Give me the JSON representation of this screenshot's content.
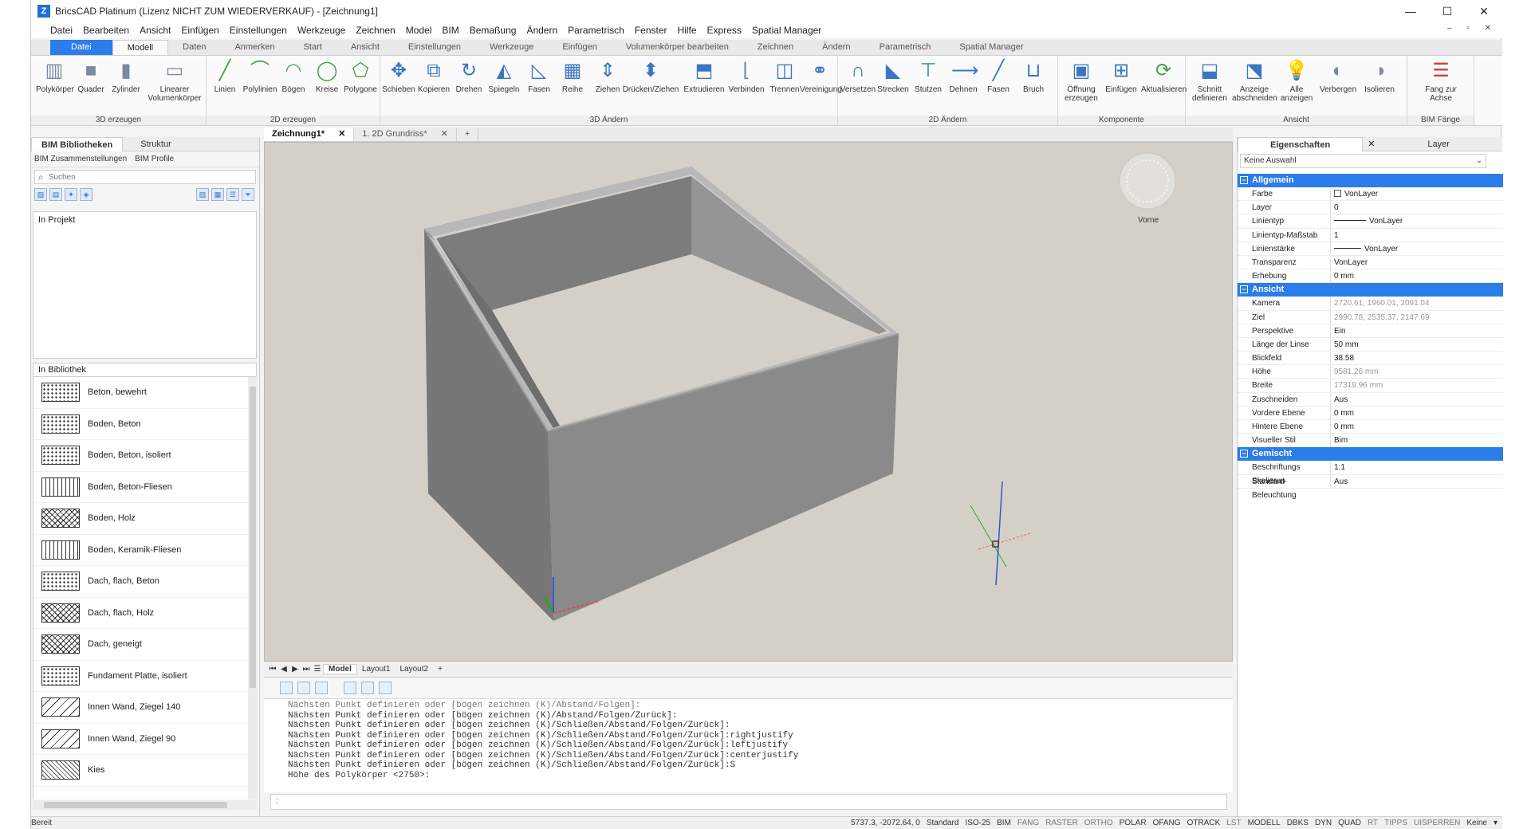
{
  "window": {
    "title": "BricsCAD Platinum (Lizenz NICHT ZUM WIEDERVERKAUF) - [Zeichnung1]",
    "min": "—",
    "max": "☐",
    "close": "✕"
  },
  "menu": [
    "Datei",
    "Bearbeiten",
    "Ansicht",
    "Einfügen",
    "Einstellungen",
    "Werkzeuge",
    "Zeichnen",
    "Model",
    "BIM",
    "Bemaßung",
    "Ändern",
    "Parametrisch",
    "Fenster",
    "Hilfe",
    "Express",
    "Spatial Manager"
  ],
  "ribbon_tabs": [
    "Datei",
    "Modell",
    "Daten",
    "Anmerken",
    "Start",
    "Ansicht",
    "Einstellungen",
    "Werkzeuge",
    "Einfügen",
    "Volumenkörper bearbeiten",
    "Zeichnen",
    "Ändern",
    "Parametrisch",
    "Spatial Manager"
  ],
  "ribbon": {
    "groups": [
      {
        "label": "3D erzeugen",
        "buttons": [
          "Polykörper",
          "Quader",
          "Zylinder",
          "Linearer Volumenkörper"
        ]
      },
      {
        "label": "2D erzeugen",
        "buttons": [
          "Linien",
          "Polylinien",
          "Bögen",
          "Kreise",
          "Polygone"
        ]
      },
      {
        "label": "3D Ändern",
        "buttons": [
          "Schieben",
          "Kopieren",
          "Drehen",
          "Spiegeln",
          "Fasen",
          "Reihe",
          "Ziehen",
          "Drücken/Ziehen",
          "Extrudieren",
          "Verbinden",
          "Trennen",
          "Vereinigung"
        ]
      },
      {
        "label": "2D Ändern",
        "buttons": [
          "Versetzen",
          "Strecken",
          "Stutzen",
          "Dehnen",
          "Fasen",
          "Bruch"
        ]
      },
      {
        "label": "Komponente",
        "buttons": [
          "Öffnung erzeugen",
          "Einfügen",
          "Aktualisieren"
        ]
      },
      {
        "label": "Ansicht",
        "buttons": [
          "Schnitt definieren",
          "Anzeige abschneiden",
          "Alle anzeigen",
          "Verbergen",
          "Isolieren"
        ]
      },
      {
        "label": "BIM Fänge",
        "buttons": [
          "Fang zur Achse"
        ]
      }
    ]
  },
  "left_panel": {
    "tabs": [
      "BIM Bibliotheken",
      "Struktur"
    ],
    "subtabs": [
      "BIM Zusammenstellungen",
      "BIM Profile"
    ],
    "search_placeholder": "Suchen",
    "project_label": "In Projekt",
    "library_label": "In Bibliothek",
    "library_items": [
      "Beton, bewehrt",
      "Boden, Beton",
      "Boden, Beton, isoliert",
      "Boden, Beton-Fliesen",
      "Boden, Holz",
      "Boden, Keramik-Fliesen",
      "Dach, flach, Beton",
      "Dach, flach, Holz",
      "Dach, geneigt",
      "Fundament Platte, isoliert",
      "Innen Wand, Ziegel 140",
      "Innen Wand, Ziegel 90",
      "Kies"
    ]
  },
  "doc_tabs": [
    "Zeichnung1*",
    "1. 2D Grundriss*"
  ],
  "viewport": {
    "navcube_label": "Vorne",
    "background": "#d4d0c8",
    "wall_color": "#8a8a8a"
  },
  "layout_tabs": [
    "Model",
    "Layout1",
    "Layout2"
  ],
  "command_history": [
    "Nächsten Punkt definieren oder [bögen zeichnen (K)/Abstand/Folgen]:",
    "Nächsten Punkt definieren oder [bögen zeichnen (K)/Abstand/Folgen/Zurück]:",
    "Nächsten Punkt definieren oder [bögen zeichnen (K)/Schließen/Abstand/Folgen/Zurück]:",
    "Nächsten Punkt definieren oder [bögen zeichnen (K)/Schließen/Abstand/Folgen/Zurück]:rightjustify",
    "Nächsten Punkt definieren oder [bögen zeichnen (K)/Schließen/Abstand/Folgen/Zurück]:leftjustify",
    "Nächsten Punkt definieren oder [bögen zeichnen (K)/Schließen/Abstand/Folgen/Zurück]:centerjustify",
    "Nächsten Punkt definieren oder [bögen zeichnen (K)/Schließen/Abstand/Folgen/Zurück]:S",
    "Höhe des Polykörper <2750>:"
  ],
  "command_prompt": ":",
  "right_panel": {
    "tabs": [
      "Eigenschaften",
      "Layer"
    ],
    "selection": "Keine Auswahl",
    "sections": [
      {
        "name": "Allgemein",
        "rows": [
          [
            "Farbe",
            "VonLayer"
          ],
          [
            "Layer",
            "0"
          ],
          [
            "Linientyp",
            "VonLayer"
          ],
          [
            "Linientyp-Maßstab",
            "1"
          ],
          [
            "Linienstärke",
            "VonLayer"
          ],
          [
            "Transparenz",
            "VonLayer"
          ],
          [
            "Erhebung",
            "0 mm"
          ]
        ]
      },
      {
        "name": "Ansicht",
        "rows": [
          [
            "Kamera",
            "2720.61, 1960.01, 2091.04"
          ],
          [
            "Ziel",
            "2990.78, 2535.37, 2147.69"
          ],
          [
            "Perspektive",
            "Ein"
          ],
          [
            "Länge der Linse",
            "50 mm"
          ],
          [
            "Blickfeld",
            "38.58"
          ],
          [
            "Höhe",
            "9581.26 mm"
          ],
          [
            "Breite",
            "17319.96 mm"
          ],
          [
            "Zuschneiden",
            "Aus"
          ],
          [
            "Vordere Ebene",
            "0 mm"
          ],
          [
            "Hintere Ebene",
            "0 mm"
          ],
          [
            "Visueller Stil",
            "Bim"
          ]
        ]
      },
      {
        "name": "Gemischt",
        "rows": [
          [
            "Beschriftungs Skalierun",
            "1:1"
          ],
          [
            "Standard-Beleuchtung",
            "Aus"
          ]
        ]
      }
    ]
  },
  "status": {
    "ready": "Bereit",
    "coords": "5737.3, -2072.64, 0",
    "items": [
      "Standard",
      "ISO-25",
      "BIM",
      "FANG",
      "RASTER",
      "ORTHO",
      "POLAR",
      "OFANG",
      "OTRACK",
      "LST",
      "MODELL",
      "DBKS",
      "DYN",
      "QUAD",
      "RT",
      "TIPPS",
      "UISPERREN",
      "Keine"
    ]
  },
  "colors": {
    "accent": "#2b7de9"
  }
}
